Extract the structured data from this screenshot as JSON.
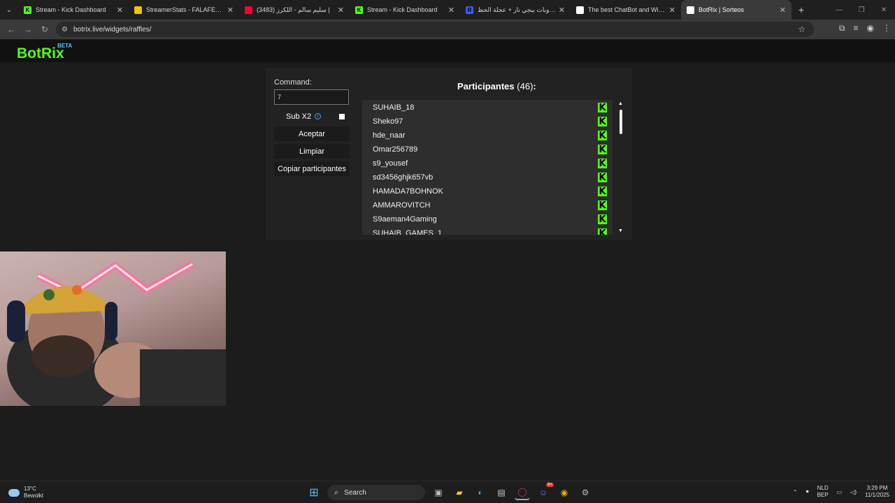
{
  "browser": {
    "tabs": [
      {
        "title": "Stream - Kick Dashboard",
        "favicon": "K",
        "color": "#53fc18",
        "active": false
      },
      {
        "title": "StreamerStats - FALAFELCO Pro",
        "favicon": "stats-icon",
        "color": "#f2c200",
        "active": false
      },
      {
        "title": "(3483) سليم سالم - اللكرز |",
        "favicon": "youtube-icon",
        "color": "#ff0033",
        "active": false
      },
      {
        "title": "Stream - Kick Dashboard",
        "favicon": "K",
        "color": "#53fc18",
        "active": false
      },
      {
        "title": "روبات ببجي نار + عجلة الحظ - n",
        "favicon": "R",
        "color": "#3b5bff",
        "active": false
      },
      {
        "title": "The best ChatBot and Widgets",
        "favicon": "botrix-icon",
        "color": "#ffffff",
        "active": false
      },
      {
        "title": "BotRix | Sorteos",
        "favicon": "botrix-icon",
        "color": "#ffffff",
        "active": true
      }
    ],
    "url": "botrix.live/widgets/raffles/"
  },
  "site": {
    "logo": "BotRix",
    "badge": "BETA"
  },
  "raffle": {
    "command_label": "Command:",
    "command_value": "7",
    "sub_label": "Sub X2",
    "accept_label": "Aceptar",
    "clear_label": "Limpiar",
    "copy_label": "Copiar participantes",
    "participants_label": "Participantes",
    "participants_count": "(46)",
    "participants_suffix": ":",
    "participants": [
      "SUHAIB_18",
      "Sheko97",
      "hde_naar",
      "Omar256789",
      "s9_yousef",
      "sd3456ghjk657vb",
      "HAMADA7BOHNOK",
      "AMMAROVITCH",
      "S9aeman4Gaming",
      "SUHAIB_GAMES_1"
    ]
  },
  "taskbar": {
    "temperature": "13°C",
    "weather": "Bewolkt",
    "search": "Search",
    "lang1": "NLD",
    "lang2": "BEP",
    "time": "3:29 PM",
    "date": "11/1/2025",
    "discord_badge": "9+"
  }
}
